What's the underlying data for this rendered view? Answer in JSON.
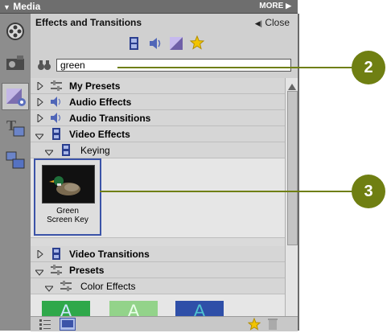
{
  "window": {
    "title": "Media",
    "more_label": "MORE"
  },
  "panel": {
    "title": "Effects and Transitions",
    "close_label": "Close"
  },
  "search": {
    "value": "green"
  },
  "tree": {
    "my_presets": "My Presets",
    "audio_effects": "Audio Effects",
    "audio_transitions": "Audio Transitions",
    "video_effects": "Video Effects",
    "keying": "Keying",
    "video_transitions": "Video Transitions",
    "presets": "Presets",
    "color_effects": "Color Effects"
  },
  "effect_item": {
    "line1": "Green",
    "line2": "Screen Key"
  },
  "callouts": {
    "c2": "2",
    "c3": "3"
  },
  "preset_letter": "A",
  "colors": {
    "callout": "#6f7f12",
    "accent": "#3b53a8"
  }
}
